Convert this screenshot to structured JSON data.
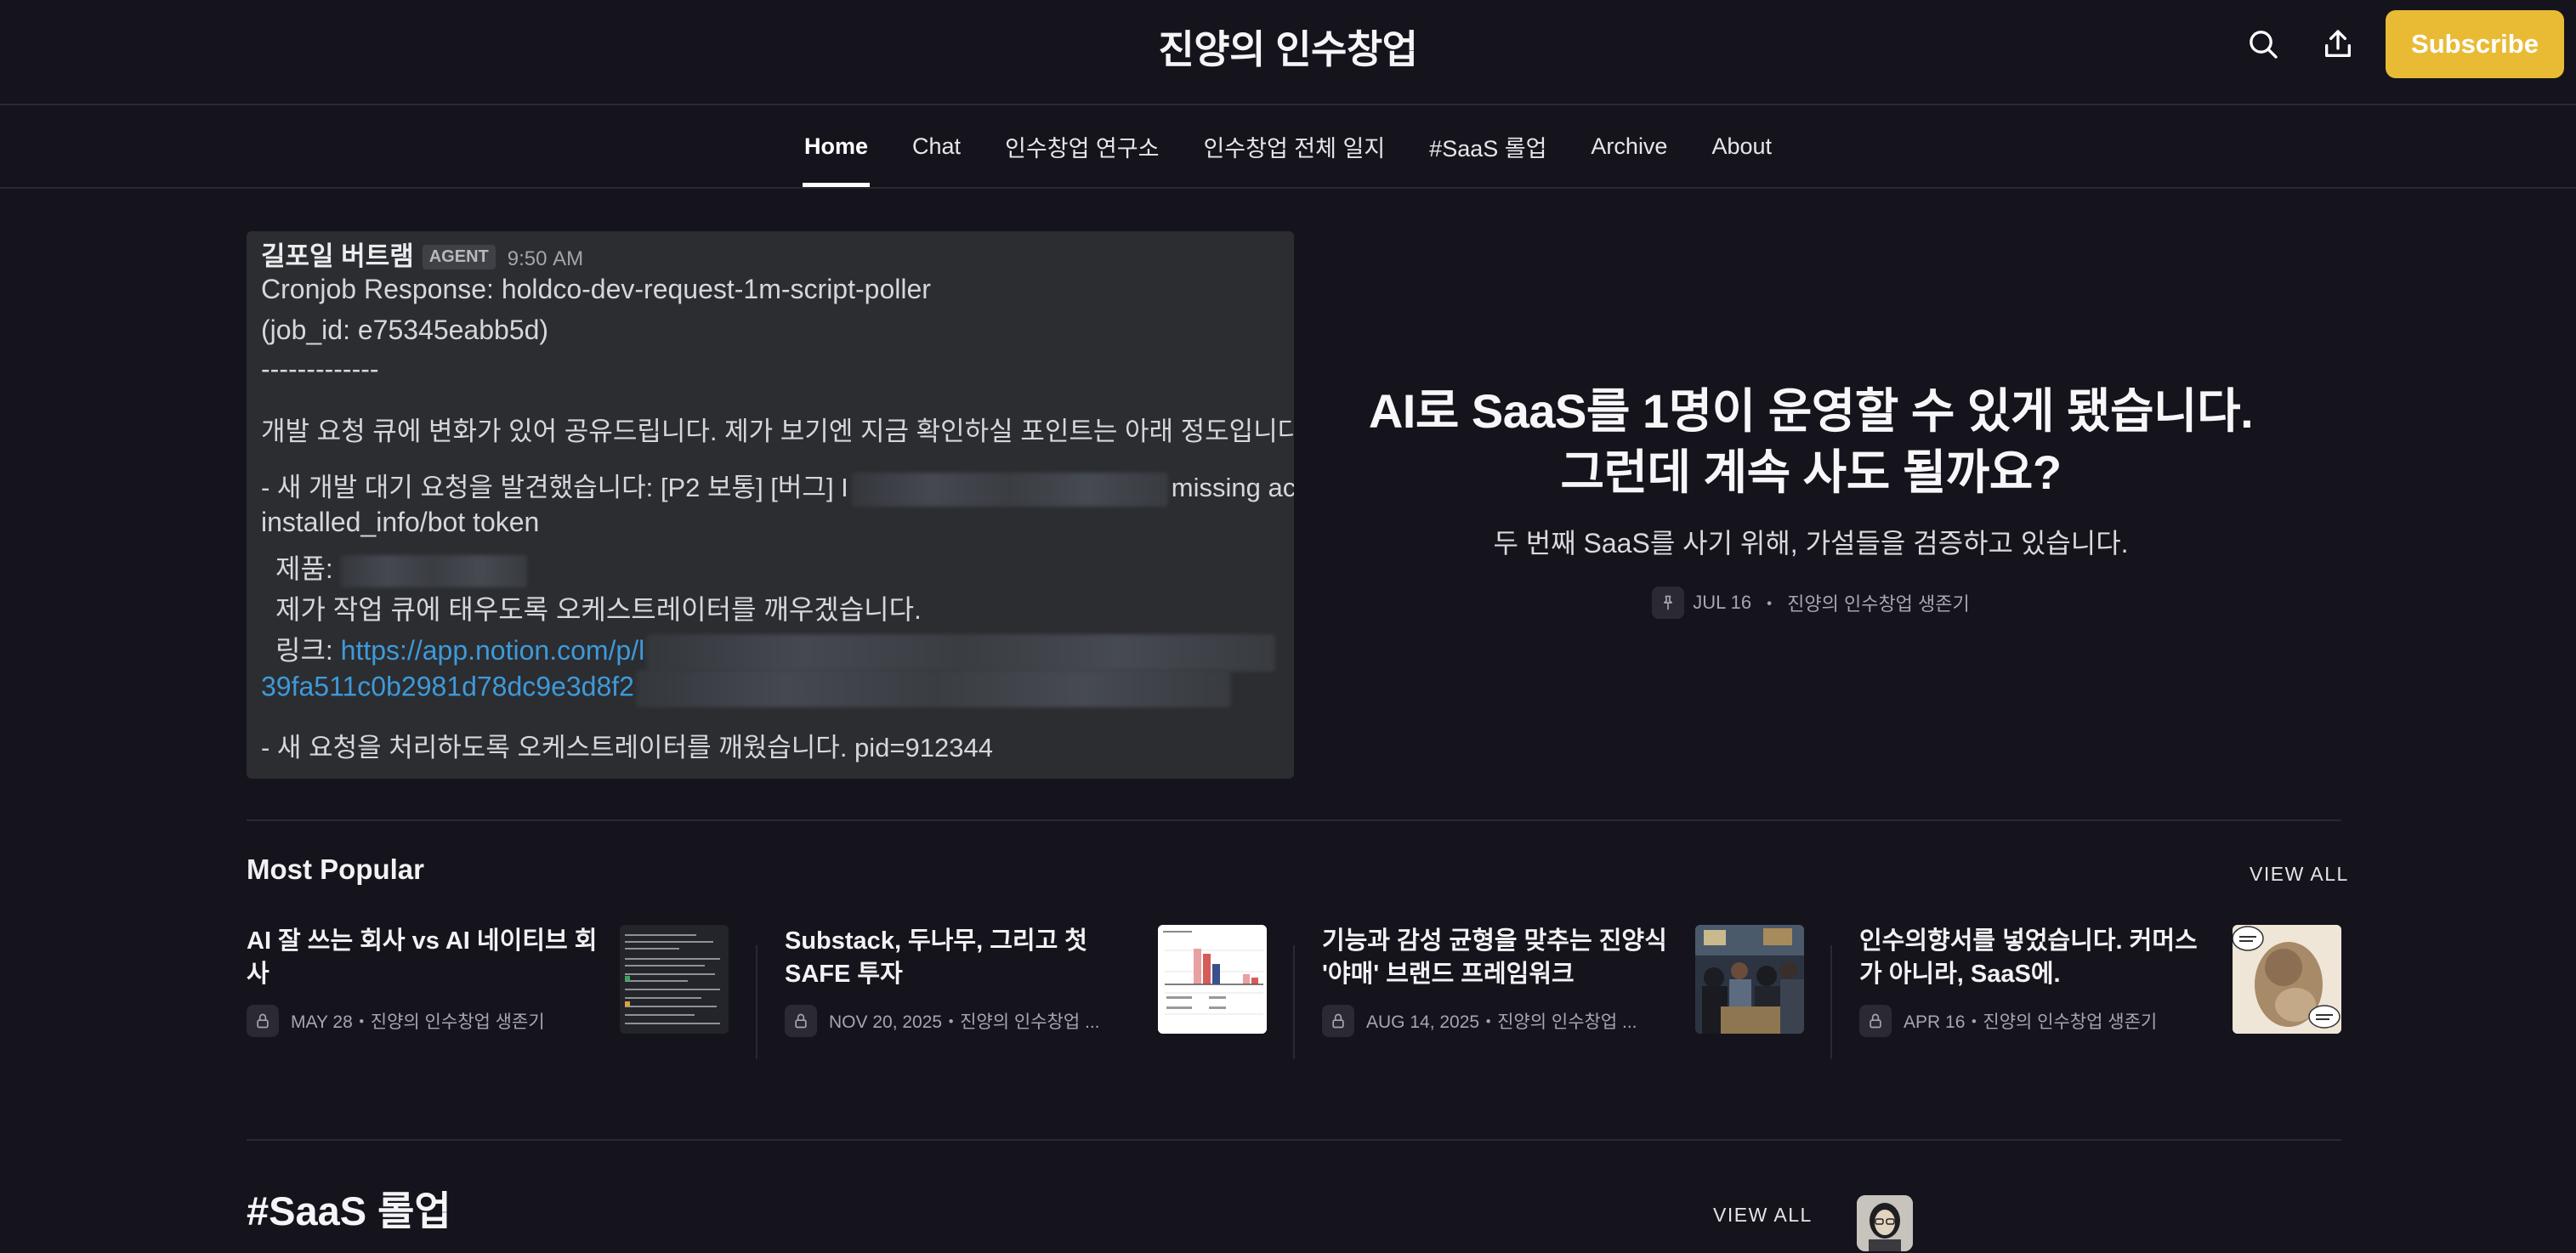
{
  "header": {
    "site_title": "진양의 인수창업",
    "subscribe_label": "Subscribe",
    "search_icon": "search-icon",
    "share_icon": "share-icon"
  },
  "nav": {
    "items": [
      {
        "label": "Home",
        "active": true
      },
      {
        "label": "Chat"
      },
      {
        "label": "인수창업 연구소"
      },
      {
        "label": "인수창업 전체 일지"
      },
      {
        "label": "#SaaS 롤업"
      },
      {
        "label": "Archive"
      },
      {
        "label": "About"
      }
    ]
  },
  "hero": {
    "image": {
      "author": "길포일 버트램",
      "agent_badge": "AGENT",
      "time": "9:50 AM",
      "line1": "Cronjob Response: holdco-dev-request-1m-script-poller",
      "line2": "(job_id: e75345eabb5d)",
      "line3": "-------------",
      "line4": "개발 요청 큐에 변화가 있어 공유드립니다. 제가 보기엔 지금 확인하실 포인트는 아래 정도입니다",
      "line5a": "- 새 개발 대기 요청을 발견했습니다: [P2 보통] [버그] I",
      "line5b": "missing ac",
      "line6": "installed_info/bot token",
      "line7": "제품:",
      "line8": "제가 작업 큐에 태우도록 오케스트레이터를 깨우겠습니다.",
      "line9_label": "링크: ",
      "line9_link": "https://app.notion.com/p/l",
      "line10": "39fa511c0b2981d78dc9e3d8f2",
      "line11": "- 새 요청을 처리하도록 오케스트레이터를 깨웠습니다. pid=912344"
    },
    "title_line1": "AI로 SaaS를 1명이 운영할 수 있게 됐습니다.",
    "title_line2": "그런데 계속 사도 될까요?",
    "subtitle": "두 번째 SaaS를 사기 위해, 가설들을 검증하고 있습니다.",
    "meta_date": "JUL 16",
    "meta_sep": "・",
    "meta_author": "진양의 인수창업 생존기",
    "pin_icon": "pin-icon"
  },
  "popular": {
    "title": "Most Popular",
    "view_all": "VIEW ALL",
    "items": [
      {
        "title": "AI 잘 쓰는 회사 vs AI 네이티브 회사",
        "date": "MAY 28",
        "sep": "・",
        "author": "진양의 인수창업 생존기"
      },
      {
        "title": "Substack, 두나무, 그리고 첫 SAFE 투자",
        "date": "NOV 20, 2025",
        "sep": "・",
        "author": "진양의 인수창업 ..."
      },
      {
        "title": "기능과 감성 균형을 맞추는 진양식 '야매' 브랜드 프레임워크",
        "date": "AUG 14, 2025",
        "sep": "・",
        "author": "진양의 인수창업 ..."
      },
      {
        "title": "인수의향서를 넣었습니다. 커머스가 아니라, SaaS에.",
        "date": "APR 16",
        "sep": "・",
        "author": "진양의 인수창업 생존기"
      }
    ]
  },
  "saas_section": {
    "title": "#SaaS 롤업",
    "view_all": "VIEW ALL"
  },
  "colors": {
    "background": "#15141d",
    "accent": "#e9bb35",
    "link": "#3e9ad9"
  }
}
